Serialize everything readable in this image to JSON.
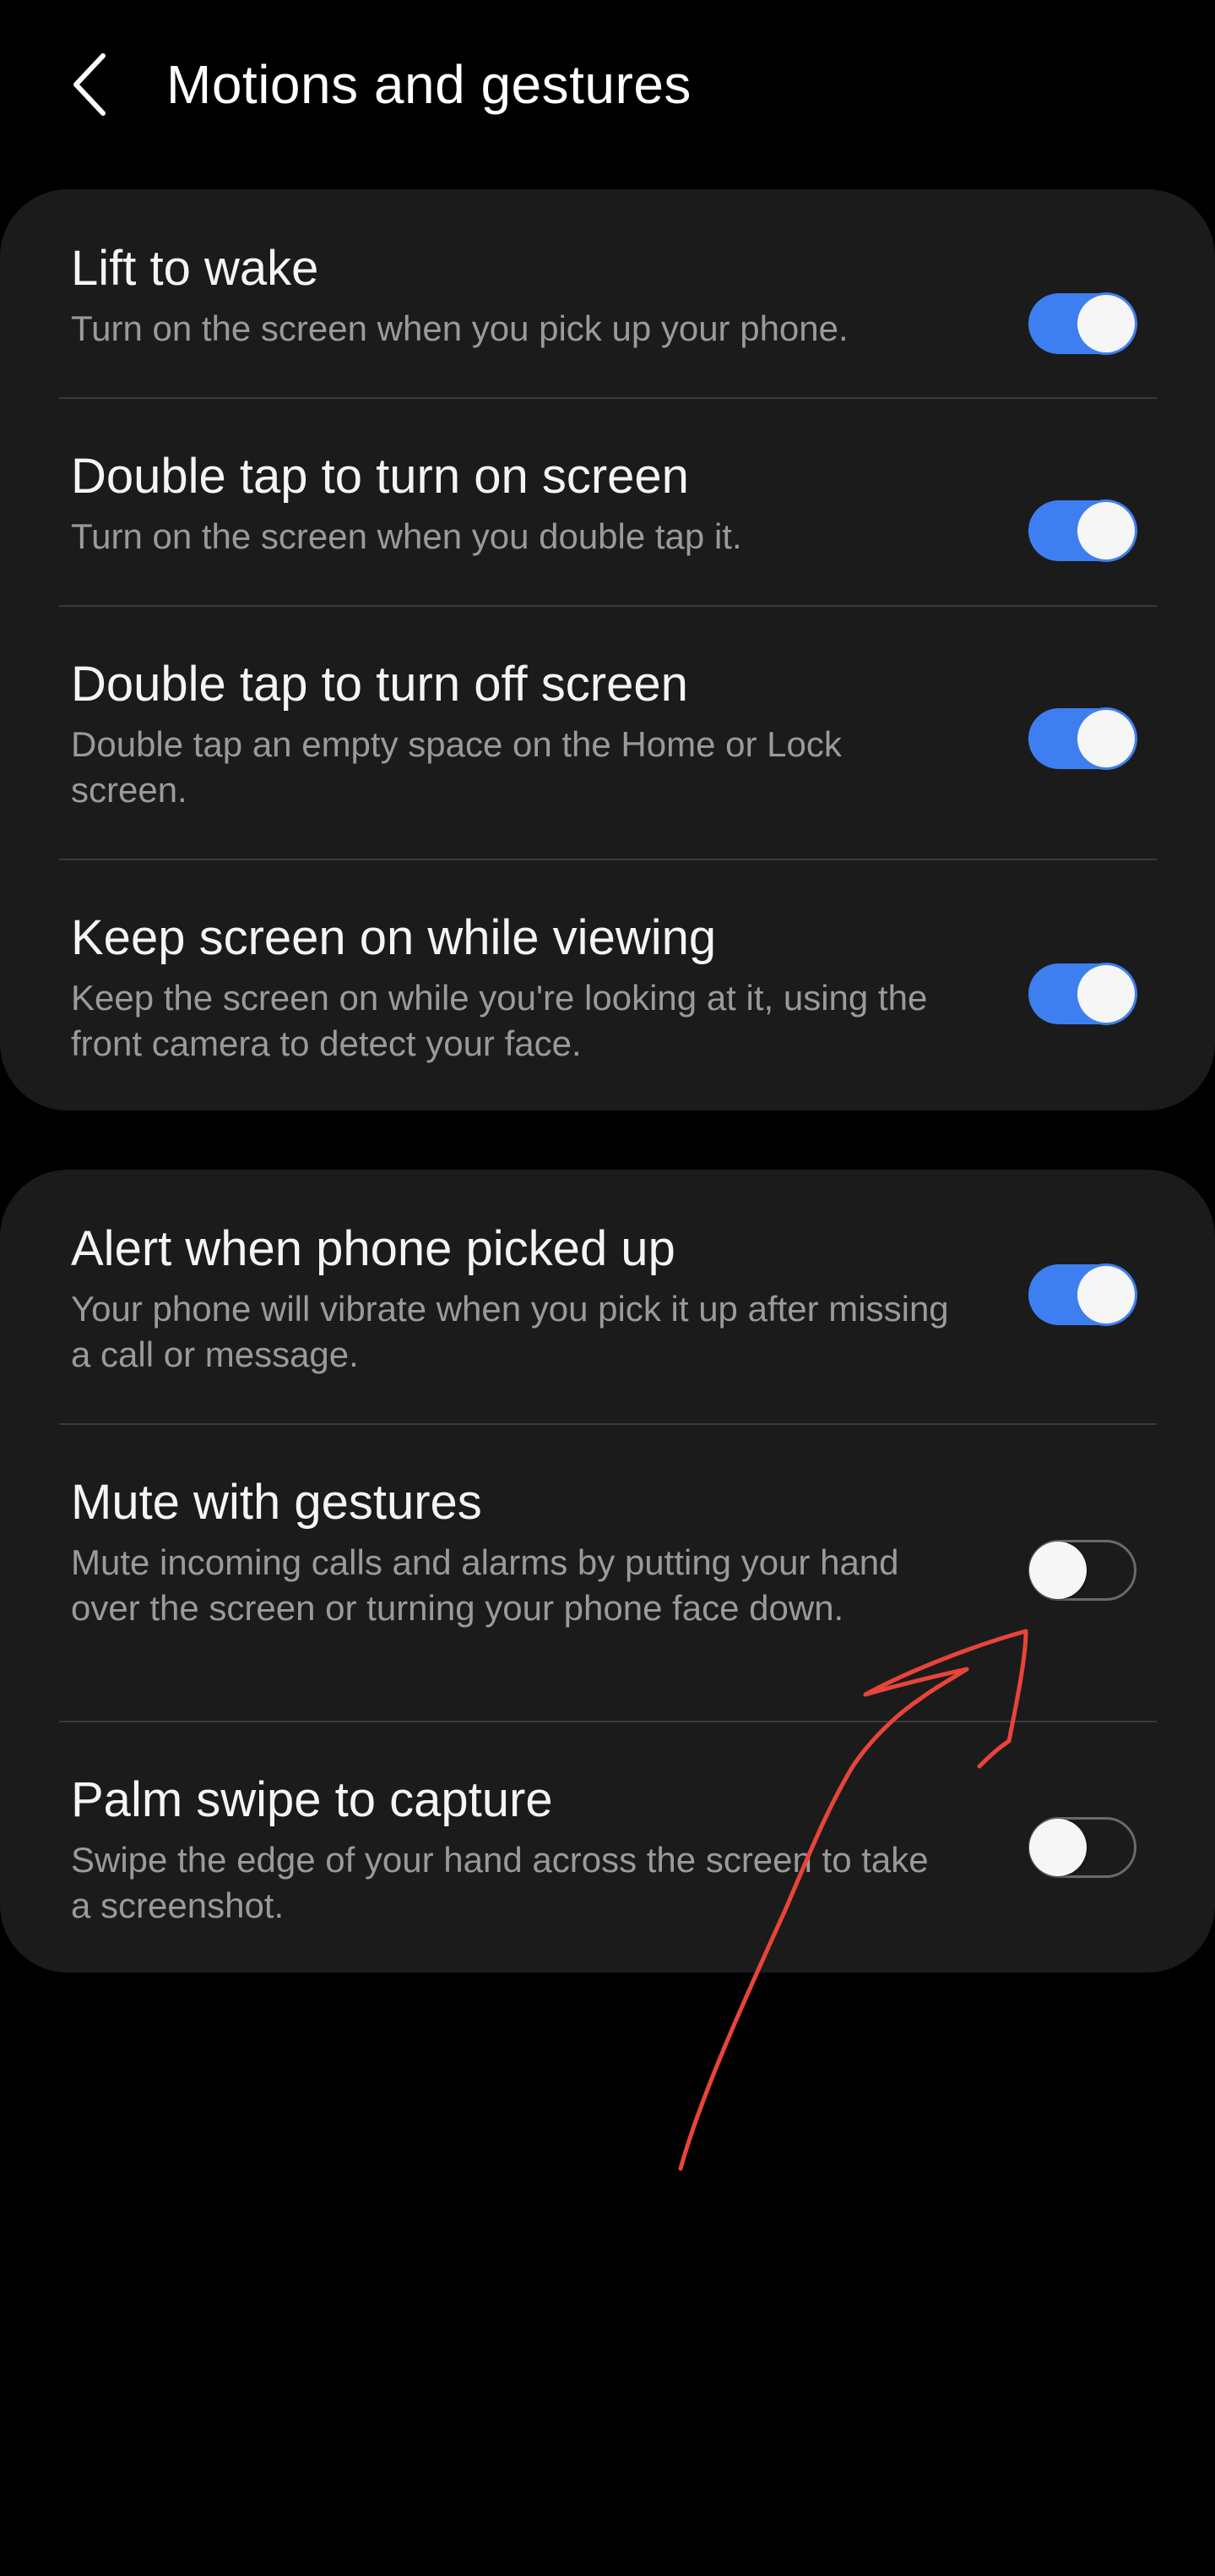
{
  "header": {
    "title": "Motions and gestures",
    "back_icon": "chevron-left-icon"
  },
  "groups": [
    {
      "items": [
        {
          "title": "Lift to wake",
          "subtitle": "Turn on the screen when you pick up your phone.",
          "enabled": true
        },
        {
          "title": "Double tap to turn on screen",
          "subtitle": "Turn on the screen when you double tap it.",
          "enabled": true
        },
        {
          "title": "Double tap to turn off screen",
          "subtitle": "Double tap an empty space on the Home or Lock screen.",
          "enabled": true
        },
        {
          "title": "Keep screen on while viewing",
          "subtitle": "Keep the screen on while you're looking at it, using the front camera to detect your face.",
          "enabled": true
        }
      ]
    },
    {
      "items": [
        {
          "title": "Alert when phone picked up",
          "subtitle": "Your phone will vibrate when you pick it up after missing a call or message.",
          "enabled": true
        },
        {
          "title": "Mute with gestures",
          "subtitle": "Mute incoming calls and alarms by putting your hand over the screen or turning your phone face down.",
          "enabled": false
        },
        {
          "title": "Palm swipe to capture",
          "subtitle": "Swipe the edge of your hand across the screen to take a screenshot.",
          "enabled": false
        }
      ]
    }
  ],
  "colors": {
    "background": "#000000",
    "card": "#1b1b1c",
    "accent": "#3d7ff0",
    "annotation": "#e8443a"
  }
}
